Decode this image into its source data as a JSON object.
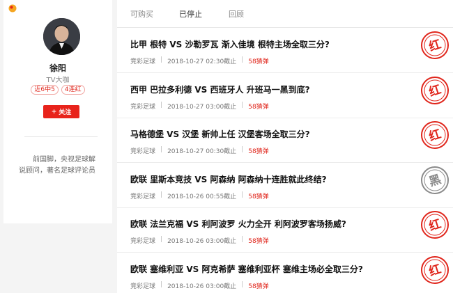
{
  "profile": {
    "name": "徐阳",
    "title": "TV大咖",
    "badges": [
      "近6中5",
      "4连红"
    ],
    "follow_label": "关注",
    "bio": "前国脚，央视足球解说顾问，著名足球评论员"
  },
  "tabs": [
    {
      "label": "可购买"
    },
    {
      "label": "已停止"
    },
    {
      "label": "回顾"
    }
  ],
  "articles": [
    {
      "title": "比甲 根特 VS 沙勒罗瓦 渐入佳境 根特主场全取三分?",
      "category": "竞彩足球",
      "deadline": "2018-10-27 02:30截止",
      "price": "58猜弹",
      "stamp": "红",
      "stamp_color": "#e0251b"
    },
    {
      "title": "西甲 巴拉多利德 VS 西班牙人 升班马一黑到底?",
      "category": "竞彩足球",
      "deadline": "2018-10-27 03:00截止",
      "price": "58猜弹",
      "stamp": "红",
      "stamp_color": "#e0251b"
    },
    {
      "title": "马格德堡 VS 汉堡 新帅上任 汉堡客场全取三分?",
      "category": "竞彩足球",
      "deadline": "2018-10-27 00:30截止",
      "price": "58猜弹",
      "stamp": "红",
      "stamp_color": "#e0251b"
    },
    {
      "title": "欧联 里斯本竞技 VS 阿森纳 阿森纳十连胜就此终结?",
      "category": "竞彩足球",
      "deadline": "2018-10-26 00:55截止",
      "price": "58猜弹",
      "stamp": "黑",
      "stamp_color": "#8a8a8a"
    },
    {
      "title": "欧联 法兰克福 VS 利阿波罗 火力全开 利阿波罗客场扬威?",
      "category": "竞彩足球",
      "deadline": "2018-10-26 03:00截止",
      "price": "58猜弹",
      "stamp": "红",
      "stamp_color": "#e0251b"
    },
    {
      "title": "欧联 塞维利亚 VS 阿克希萨 塞维利亚杯 塞维主场必全取三分?",
      "category": "竞彩足球",
      "deadline": "2018-10-26 03:00截止",
      "price": "58猜弹",
      "stamp": "红",
      "stamp_color": "#e0251b"
    }
  ],
  "colors": {
    "accent": "#e8231b",
    "background": "#f4f4f4"
  }
}
